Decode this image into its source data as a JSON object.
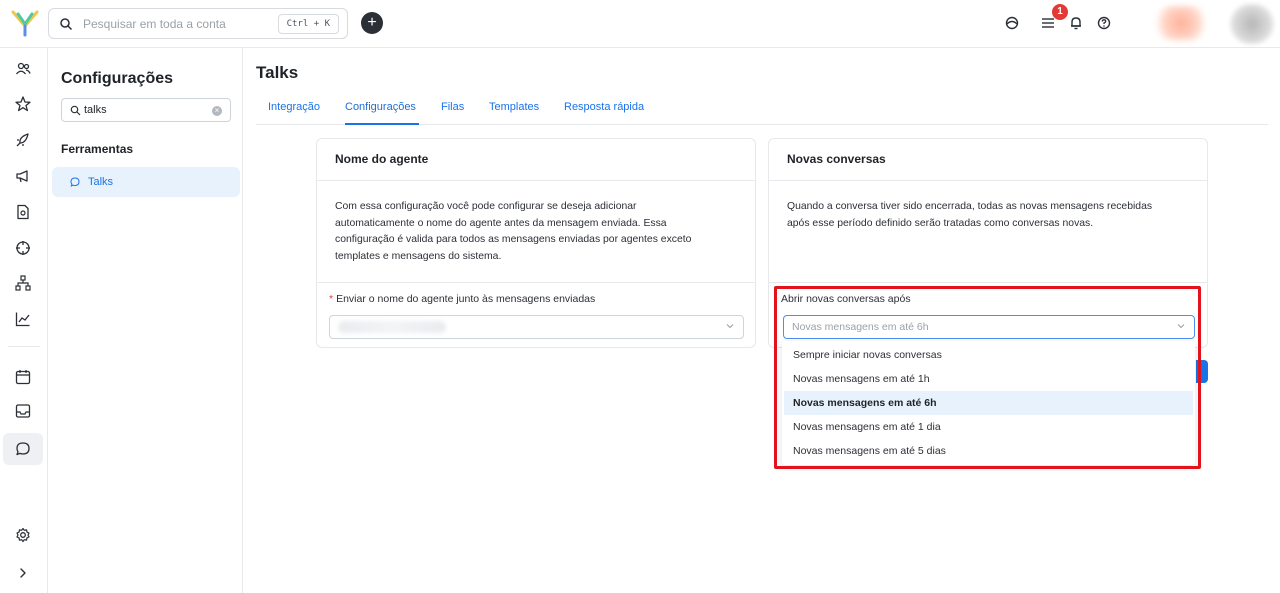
{
  "topbar": {
    "search_placeholder": "Pesquisar em toda a conta",
    "search_shortcut": "Ctrl + K",
    "add_label": "+",
    "notification_count": "1",
    "icons": [
      "logo-icon",
      "search-icon",
      "add-icon",
      "support-agent-icon",
      "tasks-list-icon",
      "bell-icon",
      "help-icon"
    ]
  },
  "rail": {
    "icons": [
      "contacts-icon",
      "star-icon",
      "rocket-icon",
      "megaphone-icon",
      "document-icon",
      "crosshair-icon",
      "org-chart-icon",
      "chart-line-icon",
      "calendar-icon",
      "inbox-icon",
      "chat-icon",
      "settings-icon",
      "chevron-right-icon"
    ],
    "active": "chat-icon"
  },
  "sidebar": {
    "title": "Configurações",
    "search_value": "talks",
    "section_title": "Ferramentas",
    "items": [
      {
        "label": "Talks",
        "icon": "chat-icon",
        "active": true
      }
    ]
  },
  "main": {
    "title": "Talks",
    "tabs": [
      {
        "label": "Integração",
        "active": false
      },
      {
        "label": "Configurações",
        "active": true
      },
      {
        "label": "Filas",
        "active": false
      },
      {
        "label": "Templates",
        "active": false
      },
      {
        "label": "Resposta rápida",
        "active": false
      }
    ]
  },
  "agent_card": {
    "title": "Nome do agente",
    "description_lines": [
      "Com essa configuração você pode configurar se deseja adicionar",
      "automaticamente o nome do agente antes da mensagem enviada. Essa",
      "configuração é valida para todos as mensagens enviadas por agentes exceto",
      "templates e mensagens do sistema."
    ],
    "required_mark": "*",
    "field_label": "Enviar o nome do agente junto às mensagens enviadas"
  },
  "conversations_card": {
    "title": "Novas conversas",
    "description_lines": [
      "Quando a conversa tiver sido encerrada, todas as novas mensagens recebidas",
      "após esse período definido serão tratadas como conversas novas."
    ],
    "field_label": "Abrir novas conversas após",
    "select_value": "Novas mensagens em até 6h",
    "options": [
      "Sempre iniciar novas conversas",
      "Novas mensagens em até 1h",
      "Novas mensagens em até 6h",
      "Novas mensagens em até 1 dia",
      "Novas mensagens em até 5 dias"
    ],
    "selected_index": 2
  },
  "colors": {
    "accent": "#1a73e8",
    "highlight_box": "#e3121b",
    "badge": "#e53935",
    "selected_option_bg": "#e8f2fc"
  }
}
